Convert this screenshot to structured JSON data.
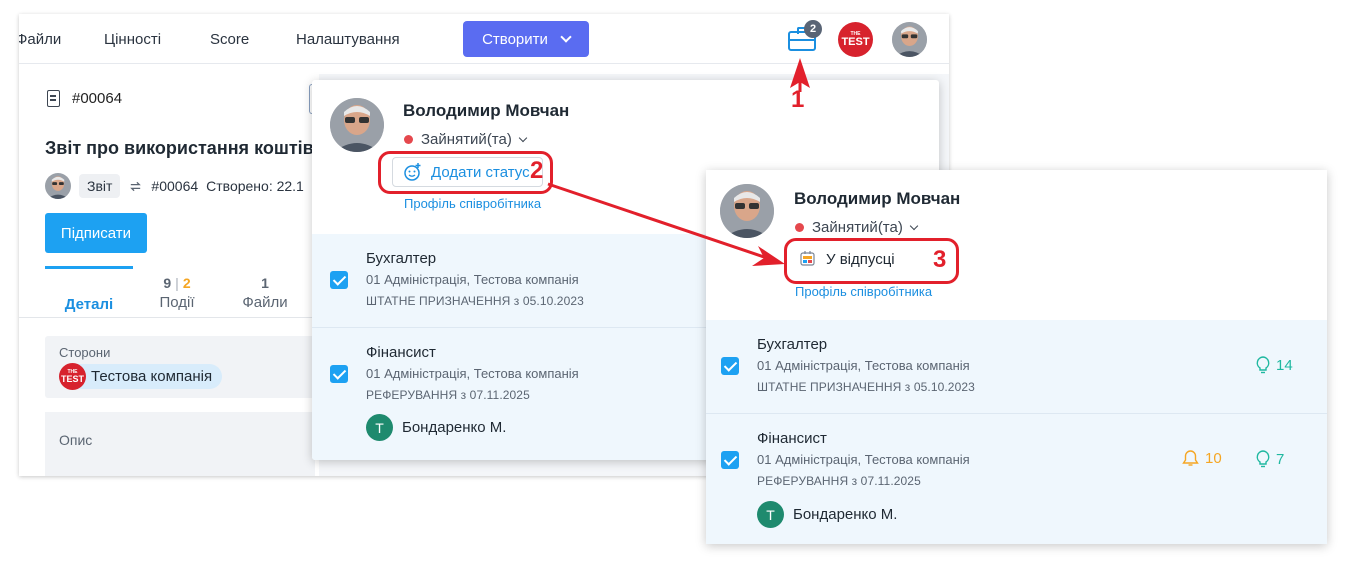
{
  "nav": {
    "items": [
      "Файли",
      "Цінності",
      "Score",
      "Налаштування"
    ],
    "create_label": "Створити",
    "briefcase_badge": "2"
  },
  "document": {
    "number": "#00064",
    "title": "Звіт про використання коштів, н",
    "tag": "Звіт",
    "ref": "#00064",
    "created": "Створено: 22.1",
    "sign_label": "Підписати",
    "tabs": [
      {
        "label": "Деталі",
        "count": "",
        "count_extra": ""
      },
      {
        "label": "Події",
        "count": "9",
        "count_extra": "2"
      },
      {
        "label": "Файли",
        "count": "1",
        "count_extra": ""
      }
    ],
    "parties_label": "Сторони",
    "company": "Тестова компанія",
    "description_label": "Опис"
  },
  "logo": {
    "text": "TEST",
    "small": "THE"
  },
  "popover_1": {
    "user_name": "Володимир Мовчан",
    "presence": "Зайнятий(та)",
    "status_button": "Додати статус",
    "profile_link": "Профіль співробітника",
    "roles": [
      {
        "title": "Бухгалтер",
        "org": "01 Адміністрація, Тестова компанія",
        "type": "ШТАТНЕ ПРИЗНАЧЕННЯ з 05.10.2023"
      },
      {
        "title": "Фінансист",
        "org": "01 Адміністрація, Тестова компанія",
        "type": "РЕФЕРУВАННЯ з 07.11.2025",
        "person_initial": "Т",
        "person_name": "Бондаренко М."
      }
    ]
  },
  "popover_2": {
    "user_name": "Володимир Мовчан",
    "presence": "Зайнятий(та)",
    "status_button": "У відпусці",
    "profile_link": "Профіль співробітника",
    "roles": [
      {
        "title": "Бухгалтер",
        "org": "01 Адміністрація, Тестова компанія",
        "type": "ШТАТНЕ ПРИЗНАЧЕННЯ з 05.10.2023",
        "ideas": "14"
      },
      {
        "title": "Фінансист",
        "org": "01 Адміністрація, Тестова компанія",
        "type": "РЕФЕРУВАННЯ з 07.11.2025",
        "alerts": "10",
        "ideas": "7",
        "person_initial": "Т",
        "person_name": "Бондаренко М."
      }
    ]
  },
  "annotations": [
    "1",
    "2",
    "3"
  ],
  "colors": {
    "accent": "#1da1f2",
    "create_button": "#5a6cf1",
    "annotation": "#e2202b",
    "busy_dot": "#e5484d",
    "brand_logo": "#d7222d"
  }
}
